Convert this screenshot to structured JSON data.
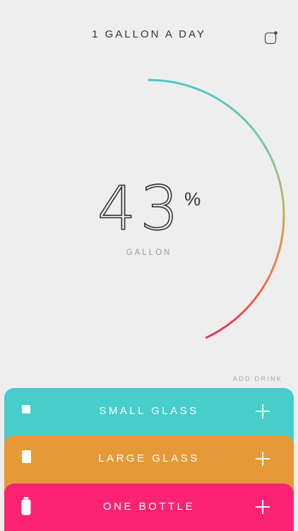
{
  "header": {
    "title": "1 GALLON A DAY",
    "settings_icon": "settings-square-icon"
  },
  "progress": {
    "percent": 43,
    "percent_text": "43",
    "percent_symbol": "%",
    "unit": "GALLON",
    "gradient_colors": [
      "#4cc8c6",
      "#9fc46a",
      "#ee8a45",
      "#e83364"
    ]
  },
  "drinks": {
    "heading": "ADD DRINK",
    "items": [
      {
        "label": "SMALL GLASS",
        "color": "#47cdca",
        "icon": "small-glass-icon"
      },
      {
        "label": "LARGE GLASS",
        "color": "#e69a37",
        "icon": "large-glass-icon"
      },
      {
        "label": "ONE BOTTLE",
        "color": "#fa2372",
        "icon": "bottle-icon"
      }
    ]
  }
}
